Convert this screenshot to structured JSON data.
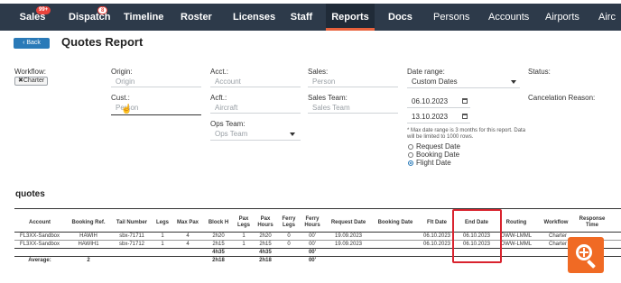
{
  "nav": {
    "items": [
      {
        "label": "Sales",
        "badge": "99+"
      },
      {
        "label": "Dispatch",
        "badge": "8"
      },
      {
        "label": "Timeline"
      },
      {
        "label": "Roster"
      },
      {
        "label": "Licenses"
      },
      {
        "label": "Staff"
      },
      {
        "label": "Reports"
      },
      {
        "label": "Docs"
      },
      {
        "label": "Persons"
      },
      {
        "label": "Accounts"
      },
      {
        "label": "Airports"
      },
      {
        "label": "Airc"
      }
    ]
  },
  "header": {
    "back_label": "Back",
    "title": "Quotes Report"
  },
  "filters": {
    "workflow_label": "Workflow:",
    "workflow_chip": "Charter",
    "origin_label": "Origin:",
    "origin_placeholder": "Origin",
    "cust_label": "Cust.:",
    "cust_placeholder": "Person",
    "acct_label": "Acct.:",
    "acct_placeholder": "Account",
    "acft_label": "Acft.:",
    "acft_placeholder": "Aircraft",
    "ops_team_label": "Ops Team:",
    "ops_team_placeholder": "Ops Team",
    "sales_label": "Sales:",
    "sales_placeholder": "Person",
    "sales_team_label": "Sales Team:",
    "sales_team_placeholder": "Sales Team",
    "date_range_label": "Date range:",
    "date_range_value": "Custom Dates",
    "date_from": "06.10.2023",
    "date_to": "13.10.2023",
    "note": "* Max date range is 3 months for this report. Data will be limited to 1000 rows.",
    "radio_request": "Request Date",
    "radio_booking": "Booking Date",
    "radio_flight": "Flight Date",
    "status_label": "Status:",
    "cancel_reason_label": "Cancelation Reason:"
  },
  "section_title": "quotes",
  "table": {
    "headers": [
      "Account",
      "Booking Ref.",
      "Tail Number",
      "Legs",
      "Max Pax",
      "Block H",
      "Pax Legs",
      "Pax Hours",
      "Ferry Legs",
      "Ferry Hours",
      "Request Date",
      "Booking Date",
      "Flt Date",
      "End Date",
      "Routing",
      "Workflow",
      "Response Time"
    ],
    "rows": [
      [
        "FL3XX-Sandbox",
        "HAWIH",
        "sbx-71711",
        "1",
        "4",
        "2h20",
        "1",
        "2h20",
        "0",
        "00'",
        "19.09.2023",
        "",
        "06.10.2023",
        "06.10.2023",
        "DWW-LMML",
        "Charter",
        ""
      ],
      [
        "FL3XX-Sandbox",
        "HAWIH1",
        "sbx-71712",
        "1",
        "4",
        "2h15",
        "1",
        "2h15",
        "0",
        "00'",
        "19.09.2023",
        "",
        "06.10.2023",
        "06.10.2023",
        "DWW-LMML",
        "Charter",
        ""
      ]
    ],
    "totals": [
      "",
      "",
      "",
      "",
      "",
      "4h35",
      "",
      "4h35",
      "",
      "00'",
      "",
      "",
      "",
      "",
      "",
      "",
      ""
    ],
    "average": [
      "Average:",
      "2",
      "",
      "",
      "",
      "2h18",
      "",
      "2h18",
      "",
      "00'",
      "",
      "",
      "",
      "",
      "",
      "",
      ""
    ]
  },
  "colors": {
    "nav_bg": "#2d3a4a",
    "accent": "#e8613c",
    "highlight": "#d9232e",
    "zoom": "#f06a24",
    "primary": "#2a7ab8"
  }
}
